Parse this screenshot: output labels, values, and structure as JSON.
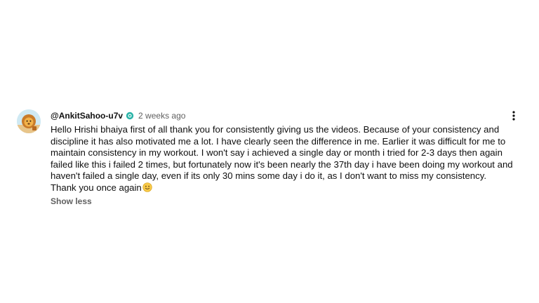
{
  "comment": {
    "author": "@AnkitSahoo-u7v",
    "timestamp": "2 weeks ago",
    "text": "Hello Hrishi bhaiya first of all thank you for consistently giving us the videos. Because of your consistency and discipline it has also motivated me a lot. I have clearly seen the difference in me. Earlier it was difficult for me to maintain consistency in my workout. I won't say i achieved a single day or month i tried for 2-3 days then again failed like this i failed 2 times, but fortunately now it's been nearly the 37th day i have been doing my workout and haven't failed a single day, even if its only 30 mins some day i do it, as I don't want to miss my consistency. Thank you once again",
    "show_less_label": "Show less",
    "emoji": "slightly-smiling-face-icon",
    "badge": "member-badge-icon",
    "menu_icon": "more-vert-icon",
    "avatar": "lion-avatar"
  },
  "colors": {
    "text_primary": "#0f0f0f",
    "text_secondary": "#606060",
    "badge": "#2bb3a8"
  }
}
